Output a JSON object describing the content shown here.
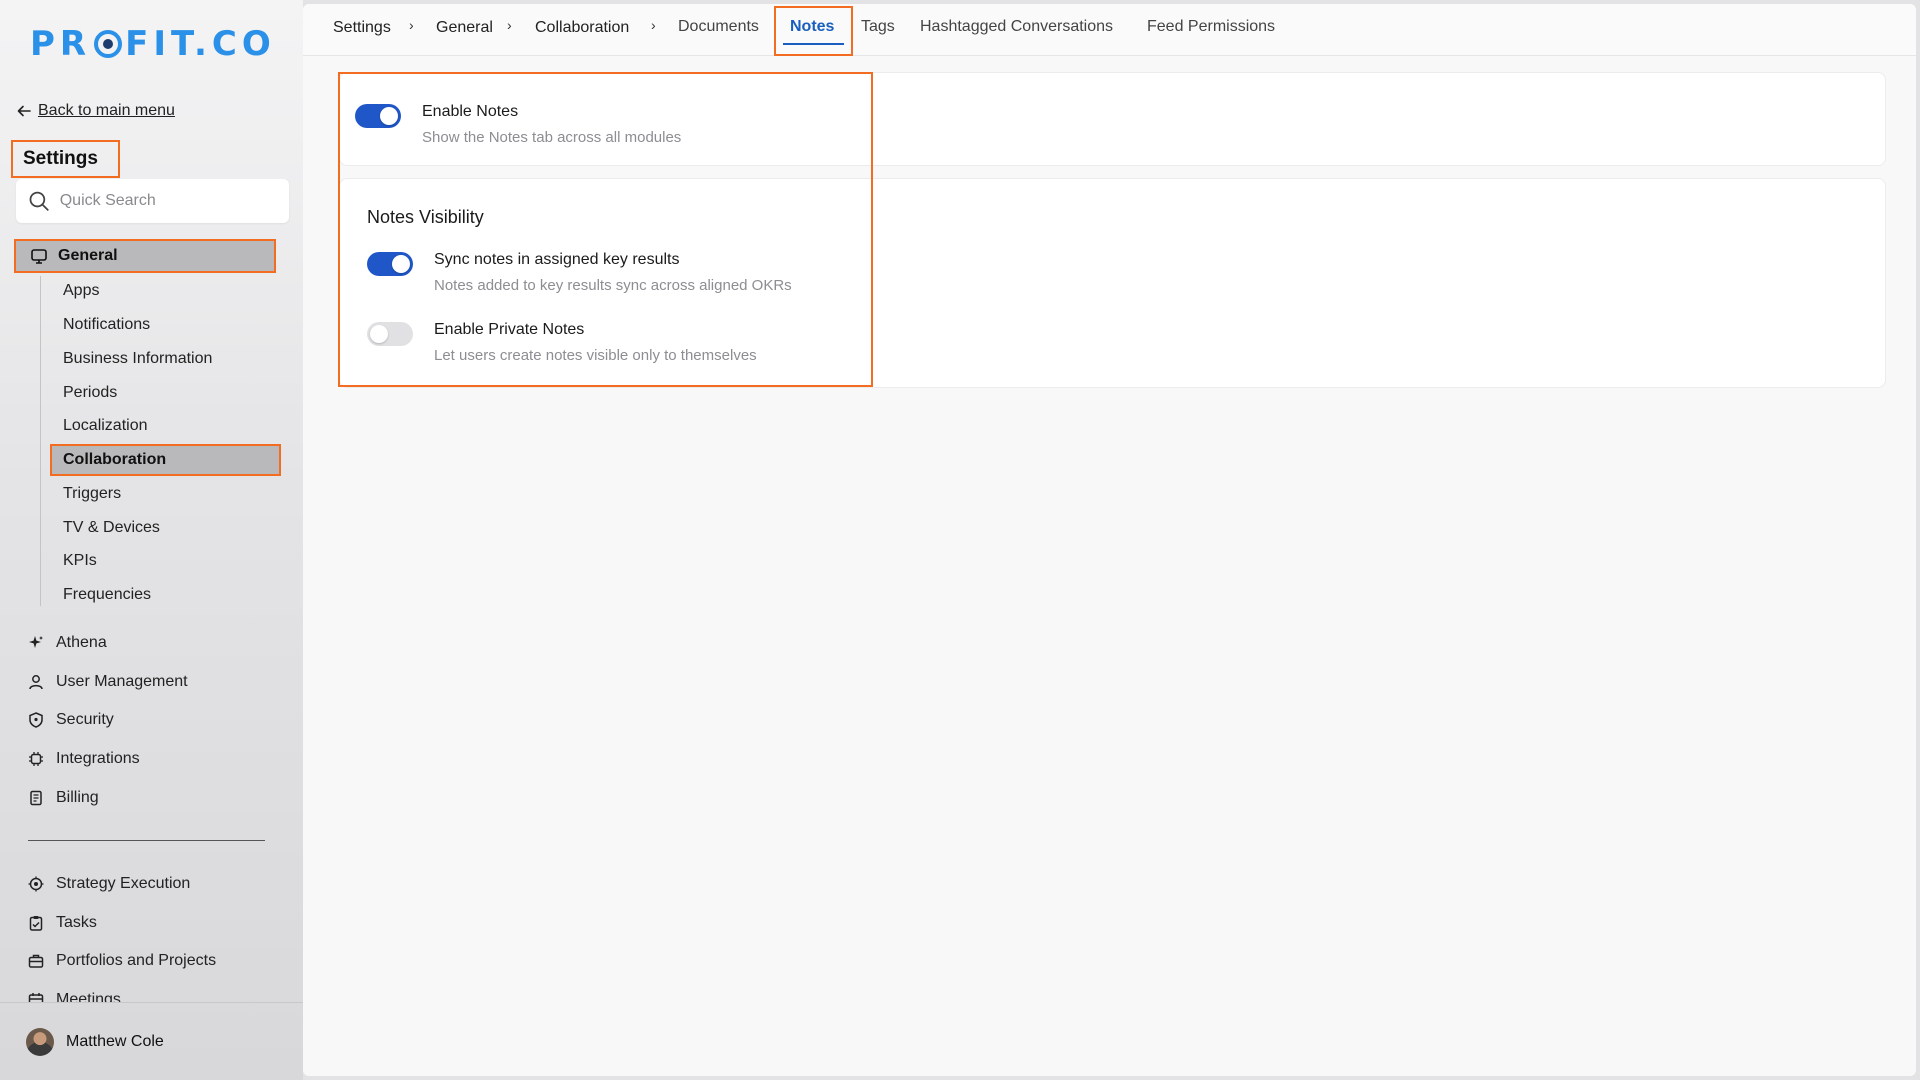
{
  "brand": {
    "logo_left": "PR",
    "logo_right": "FIT.CO",
    "color": "#2a90e8"
  },
  "sidebar": {
    "back_label": "Back to main menu",
    "title": "Settings",
    "search_placeholder": "Quick Search",
    "general": {
      "label": "General",
      "icon": "monitor-icon"
    },
    "general_items": [
      {
        "label": "Apps"
      },
      {
        "label": "Notifications"
      },
      {
        "label": "Business Information"
      },
      {
        "label": "Periods"
      },
      {
        "label": "Localization"
      },
      {
        "label": "Collaboration",
        "active": true
      },
      {
        "label": "Triggers"
      },
      {
        "label": "TV & Devices"
      },
      {
        "label": "KPIs"
      },
      {
        "label": "Frequencies"
      }
    ],
    "sections": [
      {
        "label": "Athena",
        "icon": "sparkle-icon"
      },
      {
        "label": "User Management",
        "icon": "user-icon"
      },
      {
        "label": "Security",
        "icon": "shield-icon"
      },
      {
        "label": "Integrations",
        "icon": "chip-icon"
      },
      {
        "label": "Billing",
        "icon": "receipt-icon"
      }
    ],
    "apps": [
      {
        "label": "Strategy Execution",
        "icon": "target-icon"
      },
      {
        "label": "Tasks",
        "icon": "clipboard-check-icon"
      },
      {
        "label": "Portfolios and Projects",
        "icon": "briefcase-icon"
      },
      {
        "label": "Meetings",
        "icon": "calendar-icon"
      }
    ],
    "user": {
      "name": "Matthew Cole"
    }
  },
  "breadcrumb": [
    "Settings",
    "General",
    "Collaboration"
  ],
  "tabs": [
    {
      "label": "Documents"
    },
    {
      "label": "Notes",
      "active": true
    },
    {
      "label": "Tags"
    },
    {
      "label": "Hashtagged Conversations"
    },
    {
      "label": "Feed Permissions"
    }
  ],
  "notes": {
    "enable": {
      "title": "Enable Notes",
      "desc": "Show the Notes tab across all modules",
      "on": true
    },
    "visibility": {
      "title": "Notes Visibility",
      "options": [
        {
          "title": "Sync notes in assigned key results",
          "desc": "Notes added to key results sync across aligned OKRs",
          "on": true
        },
        {
          "title": "Enable Private Notes",
          "desc": "Let users create notes visible only to themselves",
          "on": false
        }
      ]
    }
  },
  "colors": {
    "accent": "#1f57c8",
    "highlight": "#f26c22",
    "active_nav": "#b9b9bb"
  }
}
